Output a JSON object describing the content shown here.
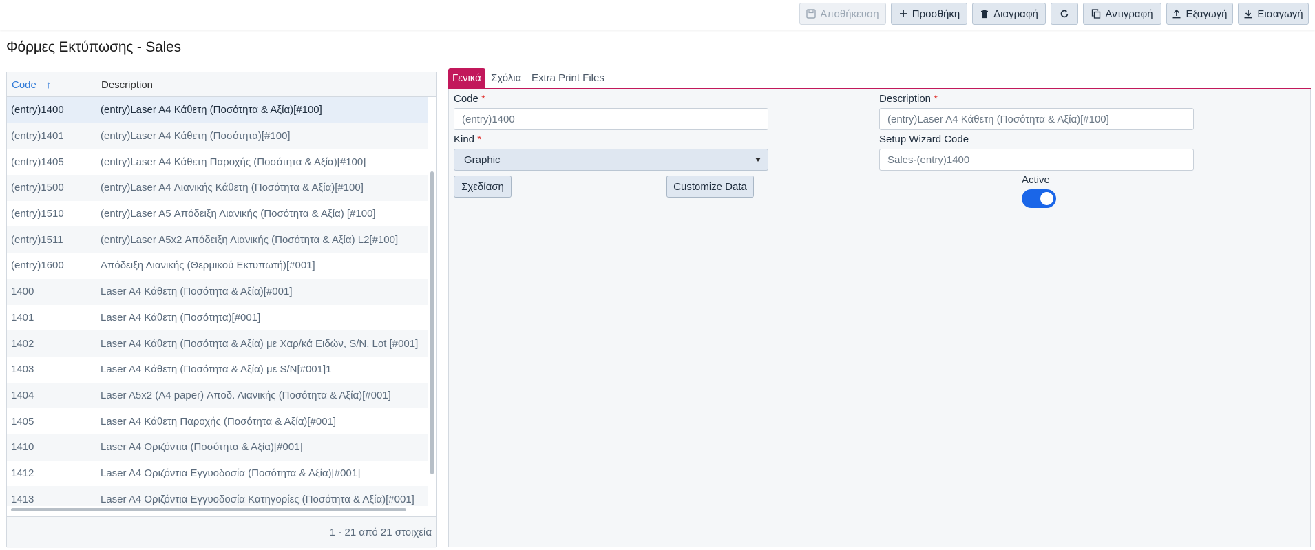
{
  "toolbar": {
    "save_label": "Αποθήκευση",
    "add_label": "Προσθήκη",
    "delete_label": "Διαγραφή",
    "copy_label": "Αντιγραφή",
    "export_label": "Εξαγωγή",
    "import_label": "Εισαγωγή"
  },
  "page": {
    "title": "Φόρμες Εκτύπωσης - Sales"
  },
  "grid": {
    "columns": {
      "code": "Code",
      "description": "Description"
    },
    "sort_indicator": "↑",
    "rows": [
      {
        "code": "(entry)1400",
        "description": "(entry)Laser A4 Κάθετη (Ποσότητα & Αξία)[#100]"
      },
      {
        "code": "(entry)1401",
        "description": "(entry)Laser A4 Κάθετη (Ποσότητα)[#100]"
      },
      {
        "code": "(entry)1405",
        "description": "(entry)Laser A4 Κάθετη Παροχής (Ποσότητα & Αξία)[#100]"
      },
      {
        "code": "(entry)1500",
        "description": "(entry)Laser A4 Λιανικής Κάθετη (Ποσότητα & Αξία)[#100]"
      },
      {
        "code": "(entry)1510",
        "description": "(entry)Laser A5 Απόδειξη Λιανικής (Ποσότητα & Αξία) [#100]"
      },
      {
        "code": "(entry)1511",
        "description": "(entry)Laser A5x2 Απόδειξη Λιανικής (Ποσότητα & Αξία) L2[#100]"
      },
      {
        "code": "(entry)1600",
        "description": "Απόδειξη Λιανικής (Θερμικού Εκτυπωτή)[#001]"
      },
      {
        "code": "1400",
        "description": "Laser A4 Κάθετη (Ποσότητα & Αξία)[#001]"
      },
      {
        "code": "1401",
        "description": "Laser A4 Κάθετη (Ποσότητα)[#001]"
      },
      {
        "code": "1402",
        "description": "Laser A4 Κάθετη (Ποσότητα & Αξία) με Χαρ/κά Ειδών, S/N, Lot [#001]"
      },
      {
        "code": "1403",
        "description": "Laser A4 Κάθετη (Ποσότητα & Αξία) με S/N[#001]1"
      },
      {
        "code": "1404",
        "description": "Laser A5x2 (A4 paper) Αποδ. Λιανικής (Ποσότητα & Αξία)[#001]"
      },
      {
        "code": "1405",
        "description": "Laser A4 Κάθετη Παροχής (Ποσότητα & Αξία)[#001]"
      },
      {
        "code": "1410",
        "description": "Laser A4 Οριζόντια (Ποσότητα & Αξία)[#001]"
      },
      {
        "code": "1412",
        "description": "Laser A4 Οριζόντια Εγγυοδοσία (Ποσότητα & Αξία)[#001]"
      },
      {
        "code": "1413",
        "description": "Laser A4 Οριζόντια Εγγυοδοσία Κατηγορίες (Ποσότητα & Αξία)[#001]"
      }
    ],
    "pager_info": "1 - 21 από 21 στοιχεία"
  },
  "details": {
    "tabs": [
      "Γενικά",
      "Σχόλια",
      "Extra Print Files"
    ],
    "required_marker": "*",
    "code_label": "Code",
    "code_value": "(entry)1400",
    "description_label": "Description",
    "description_value": "(entry)Laser A4 Κάθετη (Ποσότητα & Αξία)[#100]",
    "kind_label": "Kind",
    "kind_value": "Graphic",
    "setup_wizard_label": "Setup Wizard Code",
    "setup_wizard_value": "Sales-(entry)1400",
    "design_button": "Σχεδίαση",
    "customize_button": "Customize Data",
    "active_label": "Active",
    "active": true
  },
  "colors": {
    "accent": "#c2185b",
    "toggle": "#1a66e8",
    "link": "#2f7ad8"
  }
}
